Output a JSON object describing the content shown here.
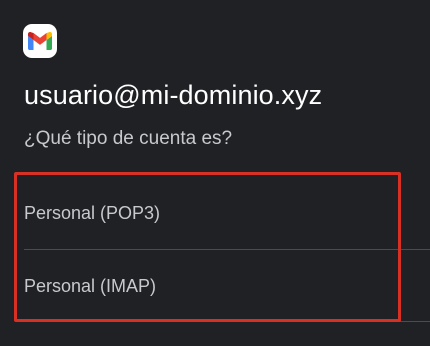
{
  "app": {
    "logo_icon": "gmail-icon"
  },
  "account": {
    "email": "usuario@mi-dominio.xyz"
  },
  "prompt": {
    "question": "¿Qué tipo de cuenta es?"
  },
  "options": [
    {
      "label": "Personal (POP3)"
    },
    {
      "label": "Personal (IMAP)"
    }
  ],
  "colors": {
    "background": "#202124",
    "highlight_border": "#d93025",
    "primary_text": "#ffffff",
    "secondary_text": "#c7c9cc"
  }
}
